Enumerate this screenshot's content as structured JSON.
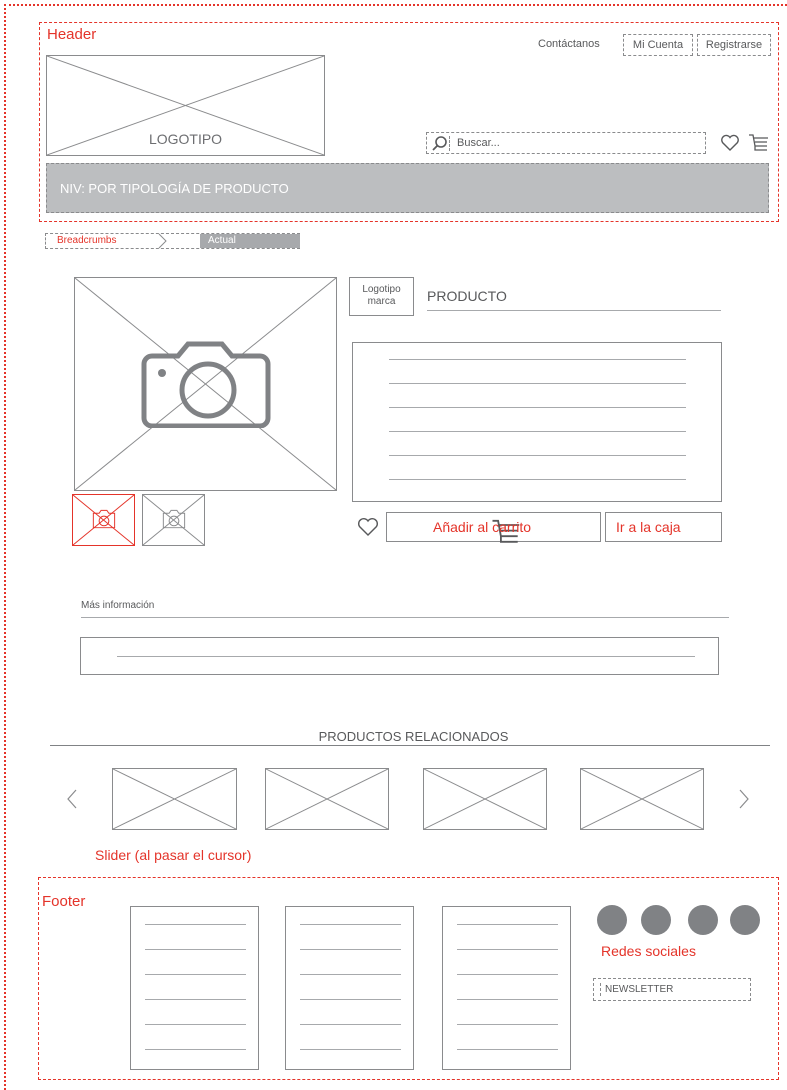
{
  "header": {
    "section_label": "Header",
    "top_links": {
      "contact": "Contáctanos",
      "account": "Mi Cuenta",
      "register": "Registrarse"
    },
    "logo_label": "LOGOTIPO",
    "search_placeholder": "Buscar...",
    "nav_label": "NIV: POR TIPOLOGÍA DE PRODUCTO"
  },
  "breadcrumbs": {
    "link": "Breadcrumbs",
    "current": "Actual"
  },
  "product": {
    "brand_logo_line1": "Logotipo",
    "brand_logo_line2": "marca",
    "title": "PRODUCTO",
    "add_to_cart": "Añadir al carrito",
    "checkout": "Ir a la caja"
  },
  "more_info": {
    "label": "Más información"
  },
  "related": {
    "title": "PRODUCTOS RELACIONADOS",
    "slider_note": "Slider (al pasar el cursor)"
  },
  "footer": {
    "section_label": "Footer",
    "social_label": "Redes sociales",
    "newsletter_label": "NEWSLETTER"
  },
  "colors": {
    "annotation": "#e4342a",
    "wire": "#8a8b8d",
    "nav_fill": "#bcbec0"
  },
  "icons": [
    "search-icon",
    "heart-icon",
    "cart-icon",
    "camera-icon",
    "chevron-left-icon",
    "chevron-right-icon",
    "breadcrumb-chevron-icon"
  ]
}
